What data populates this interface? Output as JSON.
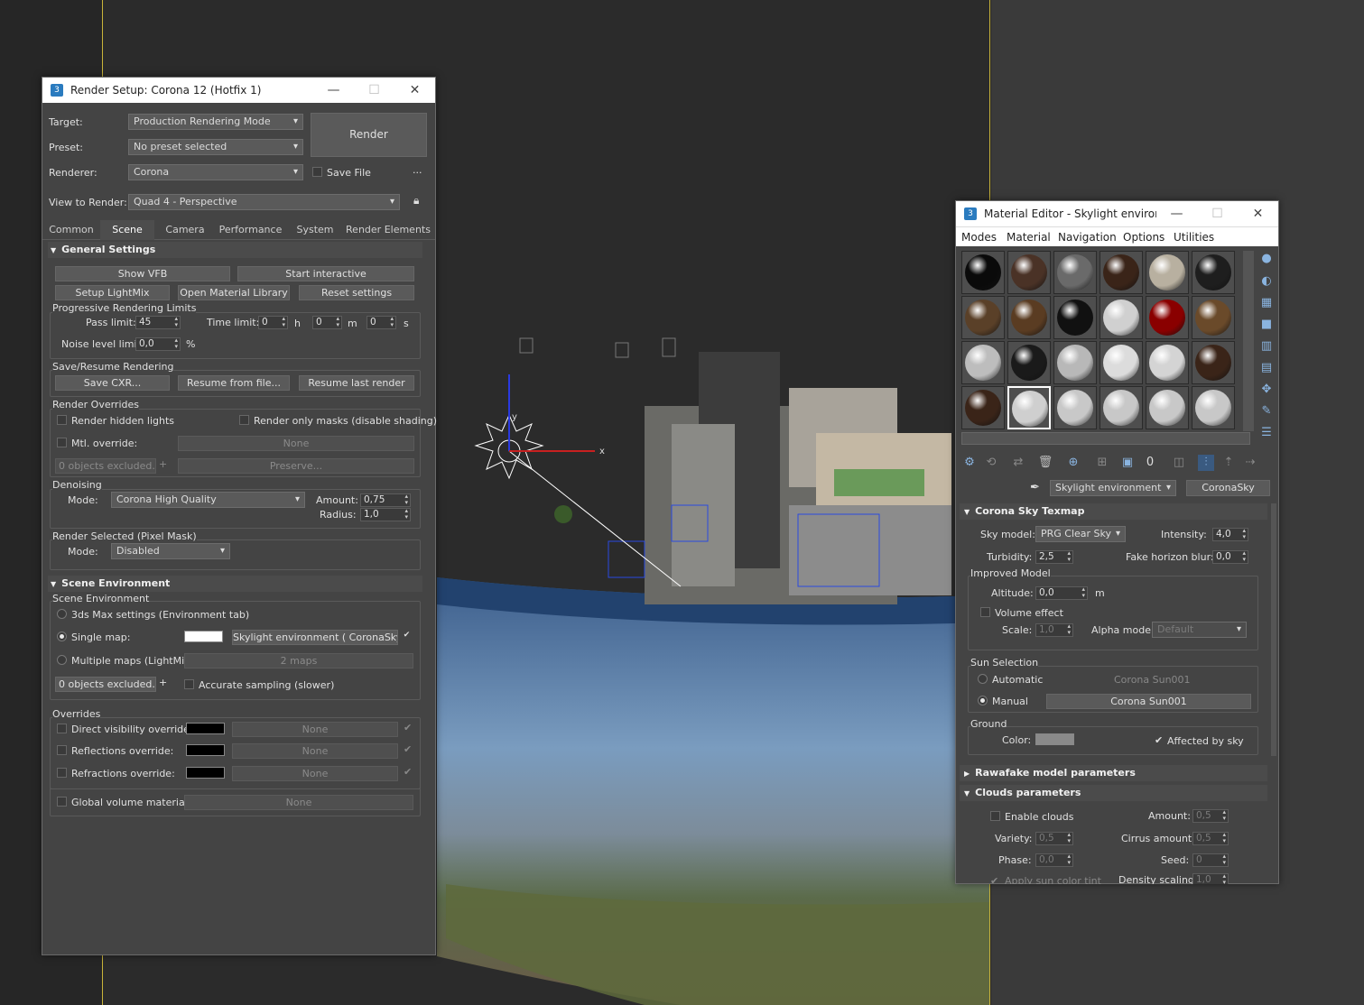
{
  "render_setup": {
    "title": "Render Setup: Corona 12 (Hotfix 1)",
    "target_label": "Target:",
    "target_value": "Production Rendering Mode",
    "preset_label": "Preset:",
    "preset_value": "No preset selected",
    "renderer_label": "Renderer:",
    "renderer_value": "Corona",
    "render_button": "Render",
    "save_file": "Save File",
    "more": "...",
    "view_label": "View to Render:",
    "view_value": "Quad 4 - Perspective",
    "tabs": [
      "Common",
      "Scene",
      "Camera",
      "Performance",
      "System",
      "Render Elements"
    ],
    "general": {
      "title": "General Settings",
      "show_vfb": "Show VFB",
      "start_interactive": "Start interactive",
      "setup_lightmix": "Setup LightMix",
      "open_material_library": "Open Material Library",
      "reset_settings": "Reset settings",
      "progressive_title": "Progressive Rendering Limits",
      "pass_limit_label": "Pass limit:",
      "pass_limit": "45",
      "time_limit_label": "Time limit:",
      "time_h": "0",
      "h": "h",
      "time_m": "0",
      "m": "m",
      "time_s": "0",
      "s": "s",
      "noise_label": "Noise level limit:",
      "noise": "0,0",
      "pct": "%",
      "save_resume_title": "Save/Resume Rendering",
      "save_cxr": "Save CXR...",
      "resume_file": "Resume from file...",
      "resume_last": "Resume last render",
      "overrides_title": "Render Overrides",
      "render_hidden": "Render hidden lights",
      "render_masks": "Render only masks (disable shading)",
      "mtl_override": "Mtl. override:",
      "none": "None",
      "objects_excluded": "0 objects excluded...",
      "plus": "+",
      "preserve": "Preserve...",
      "denoising_title": "Denoising",
      "mode_label": "Mode:",
      "denoise_mode": "Corona High Quality",
      "amount_label": "Amount:",
      "amount": "0,75",
      "radius_label": "Radius:",
      "radius": "1,0",
      "selected_title": "Render Selected (Pixel Mask)",
      "selected_mode": "Disabled"
    },
    "scene_env": {
      "title": "Scene Environment",
      "group": "Scene Environment",
      "max_settings": "3ds Max settings (Environment tab)",
      "single_map": "Single map:",
      "single_map_value": "Skylight environment  ( CoronaSky )",
      "check": "✔",
      "multiple_maps": "Multiple maps (LightMix):",
      "maps_count": "2 maps",
      "objects_excluded": "0 objects excluded...",
      "accurate": "Accurate sampling (slower)",
      "overrides_title": "Overrides",
      "direct": "Direct visibility override:",
      "reflections": "Reflections override:",
      "refractions": "Refractions override:",
      "none": "None",
      "global_volume": "Global volume material:"
    }
  },
  "material_editor": {
    "title": "Material Editor - Skylight environ...",
    "menu": [
      "Modes",
      "Material",
      "Navigation",
      "Options",
      "Utilities"
    ],
    "spheres": [
      [
        "#0a0a0a",
        "#4a3226",
        "#6a6a6a",
        "#3a2418",
        "#b8b0a0",
        "#1e1e1e"
      ],
      [
        "#5a4028",
        "#5a3c22",
        "#111111",
        "#d0d0d0",
        "#8a0000",
        "#6a4a2a"
      ],
      [
        "#bdbdbd",
        "#1a1a1a",
        "#b8b8b8",
        "#dcdcdc",
        "#d4d4d4",
        "#3a2418"
      ],
      [
        "#3a2418",
        "#cfcfcf",
        "#c8c8c8",
        "#c8c8c8",
        "#c8c8c8",
        "#c8c8c8"
      ]
    ],
    "map_name": "Skylight environment",
    "map_type": "CoronaSky",
    "sky_rollout": "Corona Sky Texmap",
    "sky_model_label": "Sky model:",
    "sky_model": "PRG Clear Sky",
    "intensity_label": "Intensity:",
    "intensity": "4,0",
    "turbidity_label": "Turbidity:",
    "turbidity": "2,5",
    "fake_horizon_label": "Fake horizon blur:",
    "fake_horizon": "0,0",
    "improved_title": "Improved Model",
    "altitude_label": "Altitude:",
    "altitude": "0,0",
    "altitude_unit": "m",
    "volume_effect": "Volume effect",
    "scale_label": "Scale:",
    "scale": "1,0",
    "alpha_label": "Alpha mode:",
    "alpha": "Default",
    "sun_title": "Sun Selection",
    "automatic": "Automatic",
    "manual": "Manual",
    "sun_name": "Corona Sun001",
    "ground_title": "Ground",
    "color_label": "Color:",
    "affected": "Affected by sky",
    "rawafake": "Rawafake model parameters",
    "clouds": "Clouds parameters",
    "enable_clouds": "Enable clouds",
    "c_amount_label": "Amount:",
    "c_amount": "0,5",
    "variety_label": "Variety:",
    "variety": "0,5",
    "cirrus_label": "Cirrus amount:",
    "cirrus": "0,5",
    "phase_label": "Phase:",
    "phase": "0,0",
    "seed_label": "Seed:",
    "seed": "0",
    "apply_sun": "Apply sun color tint",
    "density_label": "Density scaling:",
    "density": "1,0"
  },
  "viewport": {
    "axis_x": "x",
    "axis_y": "y"
  }
}
